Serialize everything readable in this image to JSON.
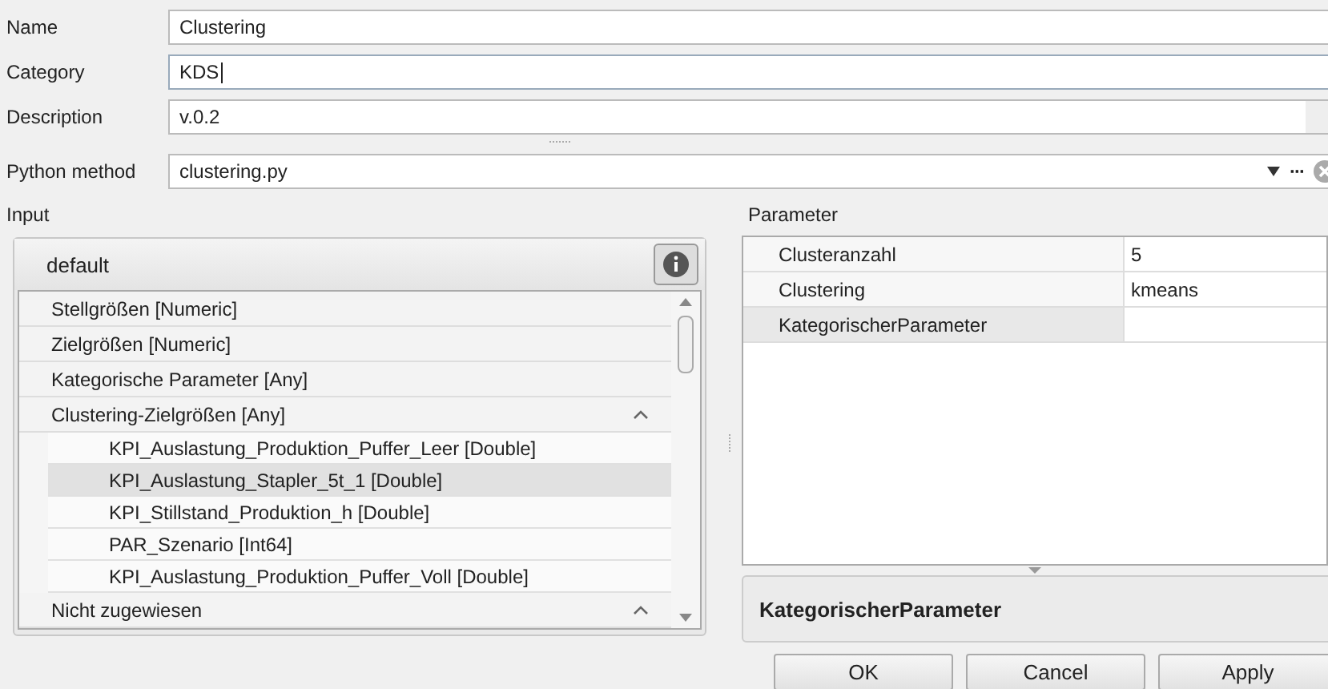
{
  "form": [
    {
      "label": "Name",
      "value": "Clustering",
      "focused": false
    },
    {
      "label": "Category",
      "value": "KDS",
      "focused": true
    },
    {
      "label": "Description",
      "value": "v.0.2",
      "focused": false
    }
  ],
  "python_method": {
    "label": "Python method",
    "value": "clustering.py",
    "more": "···"
  },
  "input": {
    "label": "Input",
    "header": "default",
    "groups": [
      {
        "label": "Stellgrößen [Numeric]",
        "collapsible": false,
        "selected": false
      },
      {
        "label": "Zielgrößen [Numeric]",
        "collapsible": false,
        "selected": false
      },
      {
        "label": "Kategorische Parameter [Any]",
        "collapsible": false,
        "selected": false
      },
      {
        "label": "Clustering-Zielgrößen [Any]",
        "collapsible": true,
        "selected": false,
        "children": [
          {
            "label": "KPI_Auslastung_Produktion_Puffer_Leer [Double]",
            "selected": false
          },
          {
            "label": "KPI_Auslastung_Stapler_5t_1 [Double]",
            "selected": true
          },
          {
            "label": "KPI_Stillstand_Produktion_h [Double]",
            "selected": false
          },
          {
            "label": "PAR_Szenario [Int64]",
            "selected": false
          },
          {
            "label": "KPI_Auslastung_Produktion_Puffer_Voll [Double]",
            "selected": false
          }
        ]
      },
      {
        "label": "Nicht zugewiesen",
        "collapsible": true,
        "selected": false
      }
    ]
  },
  "parameter": {
    "label": "Parameter",
    "rows": [
      {
        "name": "Clusteranzahl",
        "value": "5",
        "selected": false
      },
      {
        "name": "Clustering",
        "value": "kmeans",
        "selected": false
      },
      {
        "name": "KategorischerParameter",
        "selected": true
      }
    ],
    "description": "KategorischerParameter"
  },
  "buttons": [
    "OK",
    "Cancel",
    "Apply"
  ]
}
